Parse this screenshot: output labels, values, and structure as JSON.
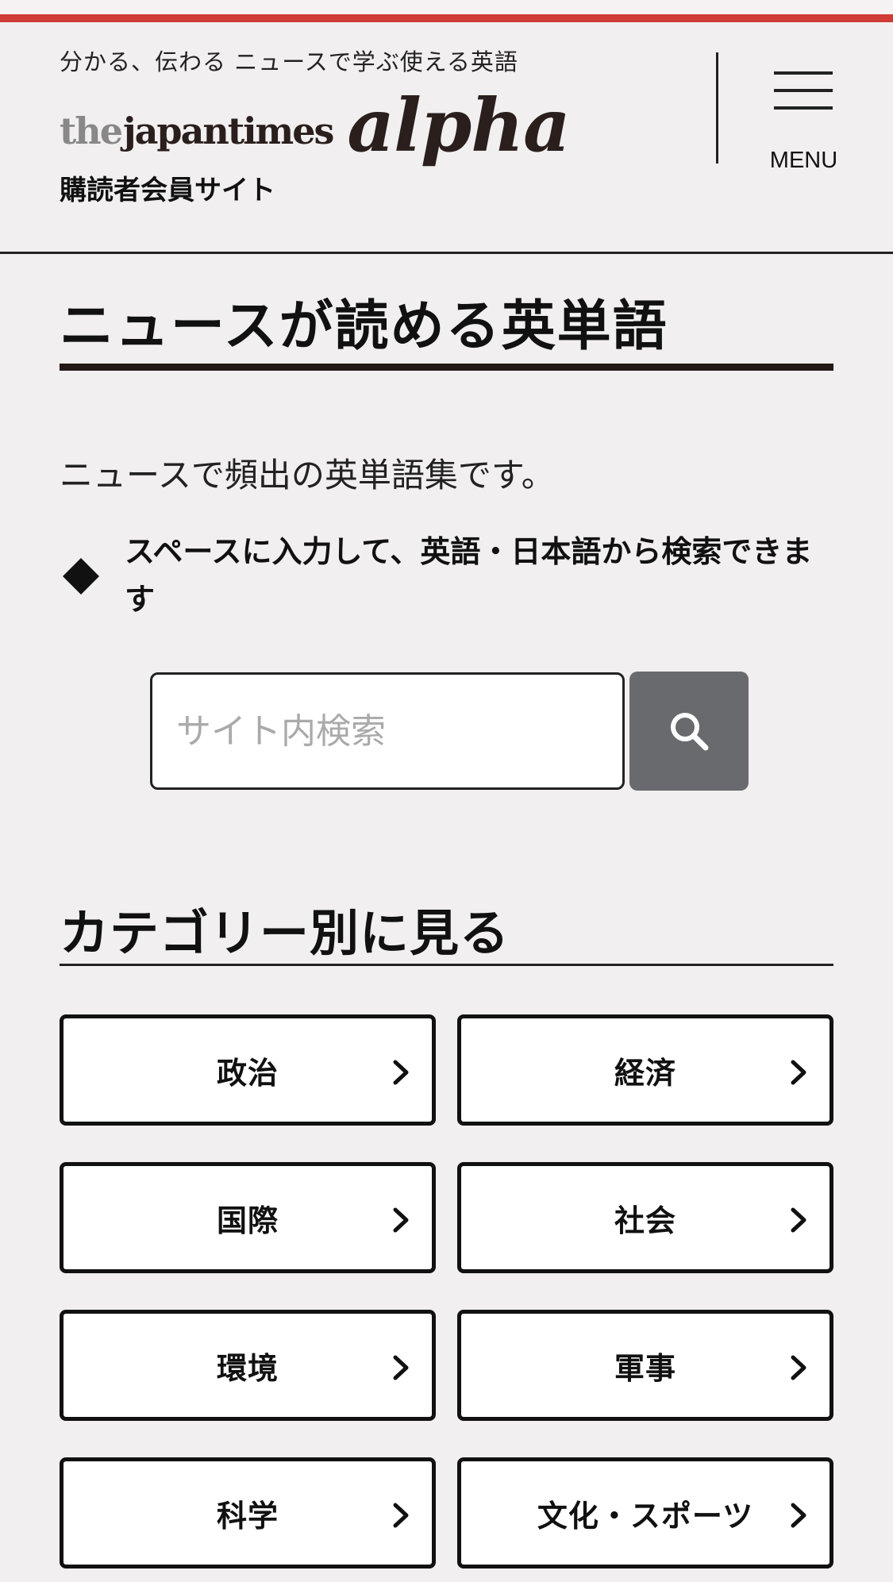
{
  "header": {
    "tagline": "分かる、伝わる ニュースで学ぶ使える英語",
    "logo_the": "the",
    "logo_japantimes": "japantimes",
    "logo_alpha": "alpha",
    "subscriber_site": "購読者会員サイト",
    "menu_label": "MENU"
  },
  "colors": {
    "accent_red": "#cf3b35",
    "search_button": "#696a6e"
  },
  "main": {
    "title": "ニュースが読める英単語",
    "intro": "ニュースで頻出の英単語集です。",
    "note": "スペースに入力して、英語・日本語から検索できます"
  },
  "search": {
    "placeholder": "サイト内検索",
    "icon": "search-icon"
  },
  "categories": {
    "heading": "カテゴリー別に見る",
    "items": [
      {
        "label": "政治"
      },
      {
        "label": "経済"
      },
      {
        "label": "国際"
      },
      {
        "label": "社会"
      },
      {
        "label": "環境"
      },
      {
        "label": "軍事"
      },
      {
        "label": "科学"
      },
      {
        "label": "文化・スポーツ"
      }
    ]
  }
}
